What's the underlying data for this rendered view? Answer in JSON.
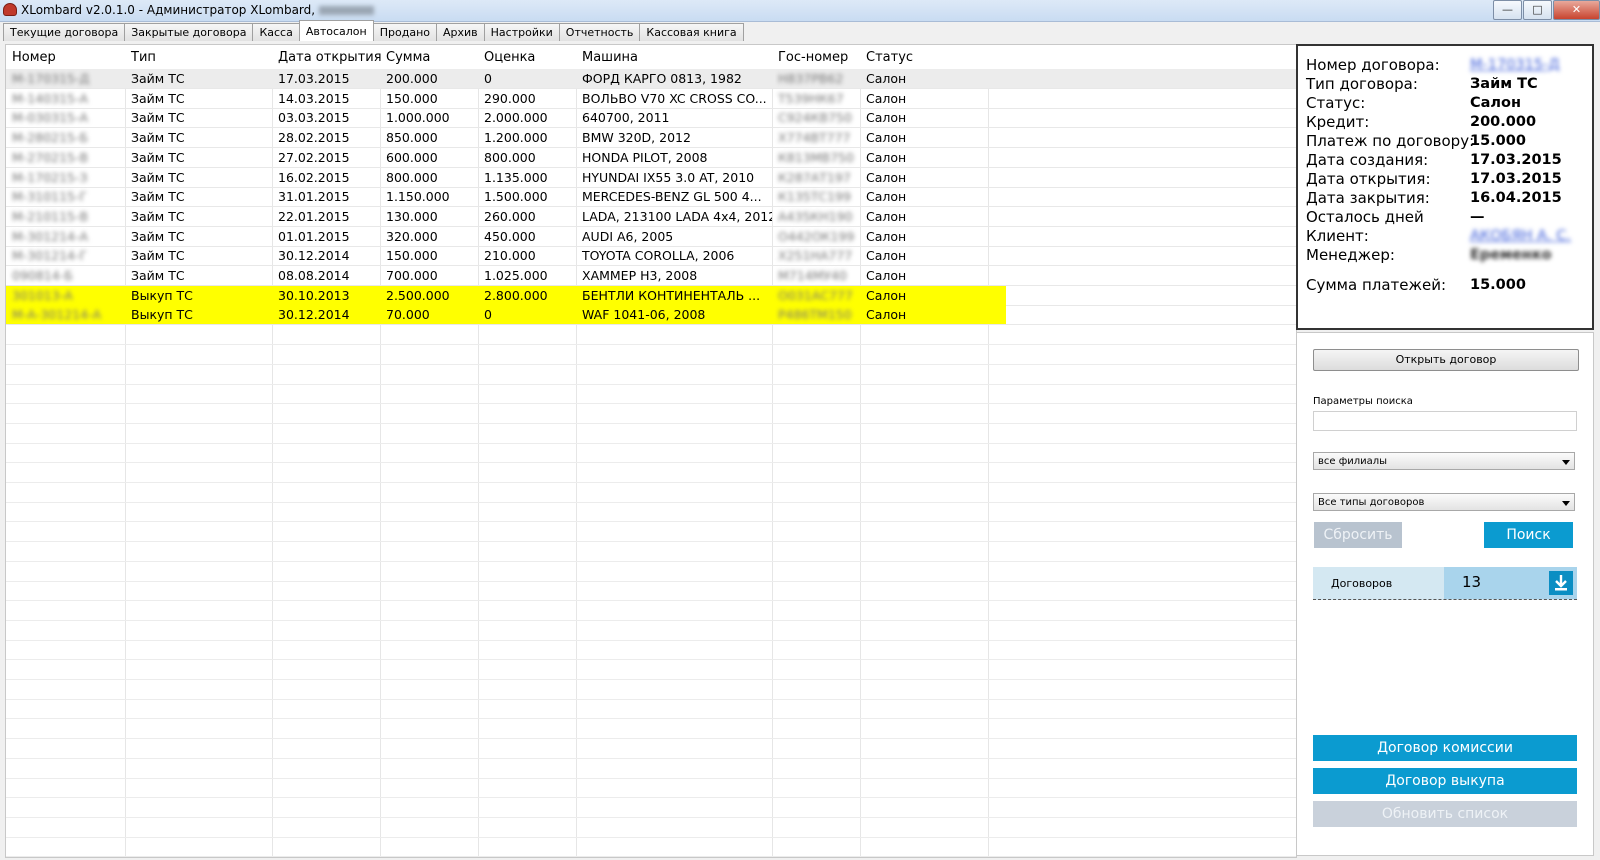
{
  "window": {
    "title": "XLombard v2.0.1.0 - Администратор XLombard,",
    "title_user": "Макаров",
    "buttons": [
      "minimize",
      "maximize",
      "close"
    ]
  },
  "tabs": [
    {
      "label": "Текущие договора",
      "width": 0
    },
    {
      "label": "Закрытые договора"
    },
    {
      "label": "Касса"
    },
    {
      "label": "Автосалон",
      "active": true
    },
    {
      "label": "Продано"
    },
    {
      "label": "Архив"
    },
    {
      "label": "Настройки"
    },
    {
      "label": "Отчетность"
    },
    {
      "label": "Кассовая книга"
    }
  ],
  "grid": {
    "columns": [
      "Номер",
      "Тип",
      "Дата открытия",
      "Сумма",
      "Оценка",
      "Машина",
      "Гос-номер",
      "Статус"
    ],
    "rows": [
      {
        "num": "М-170315-Д",
        "type": "Займ ТС",
        "date": "17.03.2015",
        "sum": "200.000",
        "est": "0",
        "car": "ФОРД КАРГО 0813, 1982",
        "plate": "Н837РВ62",
        "status": "Салон",
        "hl": "first"
      },
      {
        "num": "М-140315-А",
        "type": "Займ ТС",
        "date": "14.03.2015",
        "sum": "150.000",
        "est": "290.000",
        "car": "ВОЛЬВО V70 XC CROSS CO...",
        "plate": "Т539НК67",
        "status": "Салон"
      },
      {
        "num": "М-030315-А",
        "type": "Займ ТС",
        "date": "03.03.2015",
        "sum": "1.000.000",
        "est": "2.000.000",
        "car": "640700, 2011",
        "plate": "С924КВ750",
        "status": "Салон"
      },
      {
        "num": "М-280215-Б",
        "type": "Займ ТС",
        "date": "28.02.2015",
        "sum": "850.000",
        "est": "1.200.000",
        "car": "BMW 320D, 2012",
        "plate": "Х774ВТ777",
        "status": "Салон"
      },
      {
        "num": "М-270215-В",
        "type": "Займ ТС",
        "date": "27.02.2015",
        "sum": "600.000",
        "est": "800.000",
        "car": "HONDA PILOT, 2008",
        "plate": "К813МВ750",
        "status": "Салон"
      },
      {
        "num": "М-170215-З",
        "type": "Займ ТС",
        "date": "16.02.2015",
        "sum": "800.000",
        "est": "1.135.000",
        "car": "HYUNDAI IX55 3.0 AT, 2010",
        "plate": "К287АТ197",
        "status": "Салон"
      },
      {
        "num": "М-310115-Г",
        "type": "Займ ТС",
        "date": "31.01.2015",
        "sum": "1.150.000",
        "est": "1.500.000",
        "car": "MERCEDES-BENZ  GL 500 4...",
        "plate": "К135ТС199",
        "status": "Салон"
      },
      {
        "num": "М-210115-В",
        "type": "Займ ТС",
        "date": "22.01.2015",
        "sum": "130.000",
        "est": "260.000",
        "car": "LADA, 213100 LADA 4x4, 2012",
        "plate": "А435КН190",
        "status": "Салон"
      },
      {
        "num": "М-301214-А",
        "type": "Займ ТС",
        "date": "01.01.2015",
        "sum": "320.000",
        "est": "450.000",
        "car": "AUDI A6, 2005",
        "plate": "О442ОК199",
        "status": "Салон"
      },
      {
        "num": "М-301214-Г",
        "type": "Займ ТС",
        "date": "30.12.2014",
        "sum": "150.000",
        "est": "210.000",
        "car": "TOYOTA COROLLA, 2006",
        "plate": "Х251НА777",
        "status": "Салон"
      },
      {
        "num": "090814-Б",
        "type": "Займ ТС",
        "date": "08.08.2014",
        "sum": "700.000",
        "est": "1.025.000",
        "car": "ХАММЕР Н3, 2008",
        "plate": "М714МУ40",
        "status": "Салон"
      },
      {
        "num": "301013-А",
        "type": "Выкуп ТС",
        "date": "30.10.2013",
        "sum": "2.500.000",
        "est": "2.800.000",
        "car": "БЕНТЛИ КОНТИНЕНТАЛЬ ...",
        "plate": "О031АС777",
        "status": "Салон",
        "hl": "yellow"
      },
      {
        "num": "М-А-301214-А",
        "type": "Выкуп ТС",
        "date": "30.12.2014",
        "sum": "70.000",
        "est": "0",
        "car": "WAF 1041-06, 2008",
        "plate": "Р486ТМ150",
        "status": "Салон",
        "hl": "yellow"
      }
    ]
  },
  "details": {
    "contract_number_label": "Номер договора:",
    "contract_number_value": "М-170315-Д",
    "type_label": "Тип договора:",
    "type_value": "Займ ТС",
    "status_label": "Статус:",
    "status_value": "Салон",
    "credit_label": "Кредит:",
    "credit_value": "200.000",
    "payment_label": "Платеж по договору:",
    "payment_value": "15.000",
    "created_label": "Дата создания:",
    "created_value": "17.03.2015",
    "opened_label": "Дата открытия:",
    "opened_value": "17.03.2015",
    "closed_label": "Дата закрытия:",
    "closed_value": "16.04.2015",
    "days_left_label": "Осталось дней",
    "days_left_value": "—",
    "client_label": "Клиент:",
    "client_value": "АКОБЯН А. С.",
    "manager_label": "Менеджер:",
    "manager_value": "Еременко",
    "payments_sum_label": "Сумма платежей:",
    "payments_sum_value": "15.000"
  },
  "side": {
    "open_button": "Открыть договор",
    "search_label": "Параметры поиска",
    "search_value": "",
    "branch_select": "все филиалы",
    "type_select": "Все типы договоров",
    "reset_button": "Сбросить",
    "search_button": "Поиск",
    "count_label": "Договоров",
    "count_value": "13",
    "commission_button": "Договор комиссии",
    "buyout_button": "Договор выкупа",
    "refresh_button": "Обновить список"
  },
  "colors": {
    "accent": "#0b9bd0",
    "disabled_button": "#b8c3cf",
    "highlight_row": "#ffff00",
    "counter_bg": "#d4e8f2"
  }
}
